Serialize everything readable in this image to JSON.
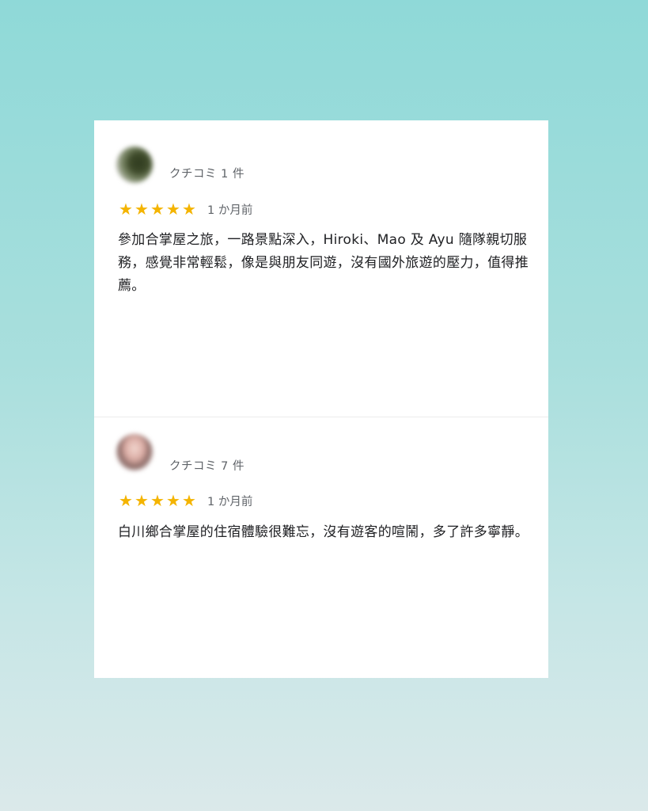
{
  "reviews": [
    {
      "review_count": "クチコミ 1 件",
      "rating": 5,
      "stars": [
        "★",
        "★",
        "★",
        "★",
        "★"
      ],
      "time": "1 か月前",
      "text": "參加合掌屋之旅，一路景點深入，Hiroki、Mao 及 Ayu 隨隊親切服務，感覺非常輕鬆，像是與朋友同遊，沒有國外旅遊的壓力，值得推薦。"
    },
    {
      "review_count": "クチコミ 7 件",
      "rating": 5,
      "stars": [
        "★",
        "★",
        "★",
        "★",
        "★"
      ],
      "time": "1 か月前",
      "text": "白川鄉合掌屋的住宿體驗很難忘，沒有遊客的喧鬧，多了許多寧靜。"
    }
  ],
  "colors": {
    "star": "#f4b400",
    "meta_text": "#5f6368",
    "body_text": "#202124",
    "card": "#ffffff"
  }
}
